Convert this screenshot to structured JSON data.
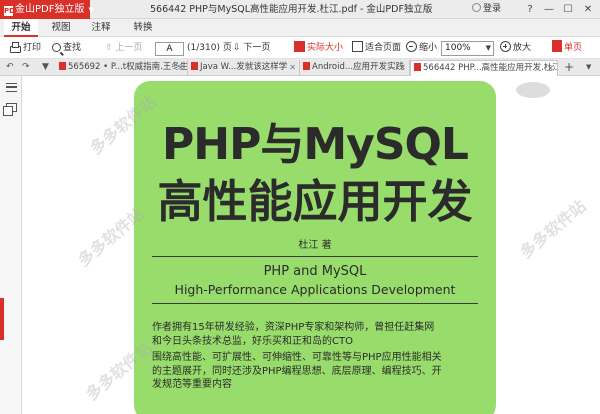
{
  "titlebar": {
    "app_name": "金山PDF独立版",
    "pdf_badge": "PDF",
    "title": "566442 PHP与MySQL高性能应用开发.杜江.pdf - 金山PDF独立版",
    "login": "登录",
    "controls": [
      "?",
      "—",
      "☐",
      "✕"
    ]
  },
  "menu": {
    "tabs": [
      "开始",
      "视图",
      "注释",
      "转换"
    ]
  },
  "toolbar": {
    "print": "打印",
    "find": "查找",
    "prev_page": "上一页",
    "page_value": "A",
    "page_count": "(1/310) 页",
    "next_page": "下一页",
    "actual_size": "实际大小",
    "fit_page": "适合页面",
    "zoom_out": "缩小",
    "zoom_value": "100%",
    "zoom_in": "放大",
    "single_page": "单页"
  },
  "doc_tabs": {
    "tabs": [
      "565692 • P...t权威指南.王冬生",
      "Java W...发就该这样学",
      "Android...应用开发实践",
      "566442 PHP...高性能应用开发.杜江"
    ],
    "active_index": 3,
    "new_tab": "+"
  },
  "cover": {
    "title_line1": "PHP与MySQL",
    "title_line2": "高性能应用开发",
    "author": "杜江  著",
    "en_line1": "PHP and MySQL",
    "en_line2": "High-Performance Applications Development",
    "para1_line1": "作者拥有15年研发经验，资深PHP专家和架构师，曾担任赶集网",
    "para1_line2": "和今日头条技术总监，好乐买和正和岛的CTO",
    "para2_line1": "围绕高性能、可扩展性、可伸缩性、可靠性等与PHP应用性能相关",
    "para2_line2": "的主题展开，同时还涉及PHP编程思想、底层原理、编程技巧、开",
    "para2_line3": "发规范等重要内容",
    "bg_color": "#98dd6c"
  },
  "watermark": "多多软件站",
  "colors": {
    "accent": "#d9302a"
  }
}
